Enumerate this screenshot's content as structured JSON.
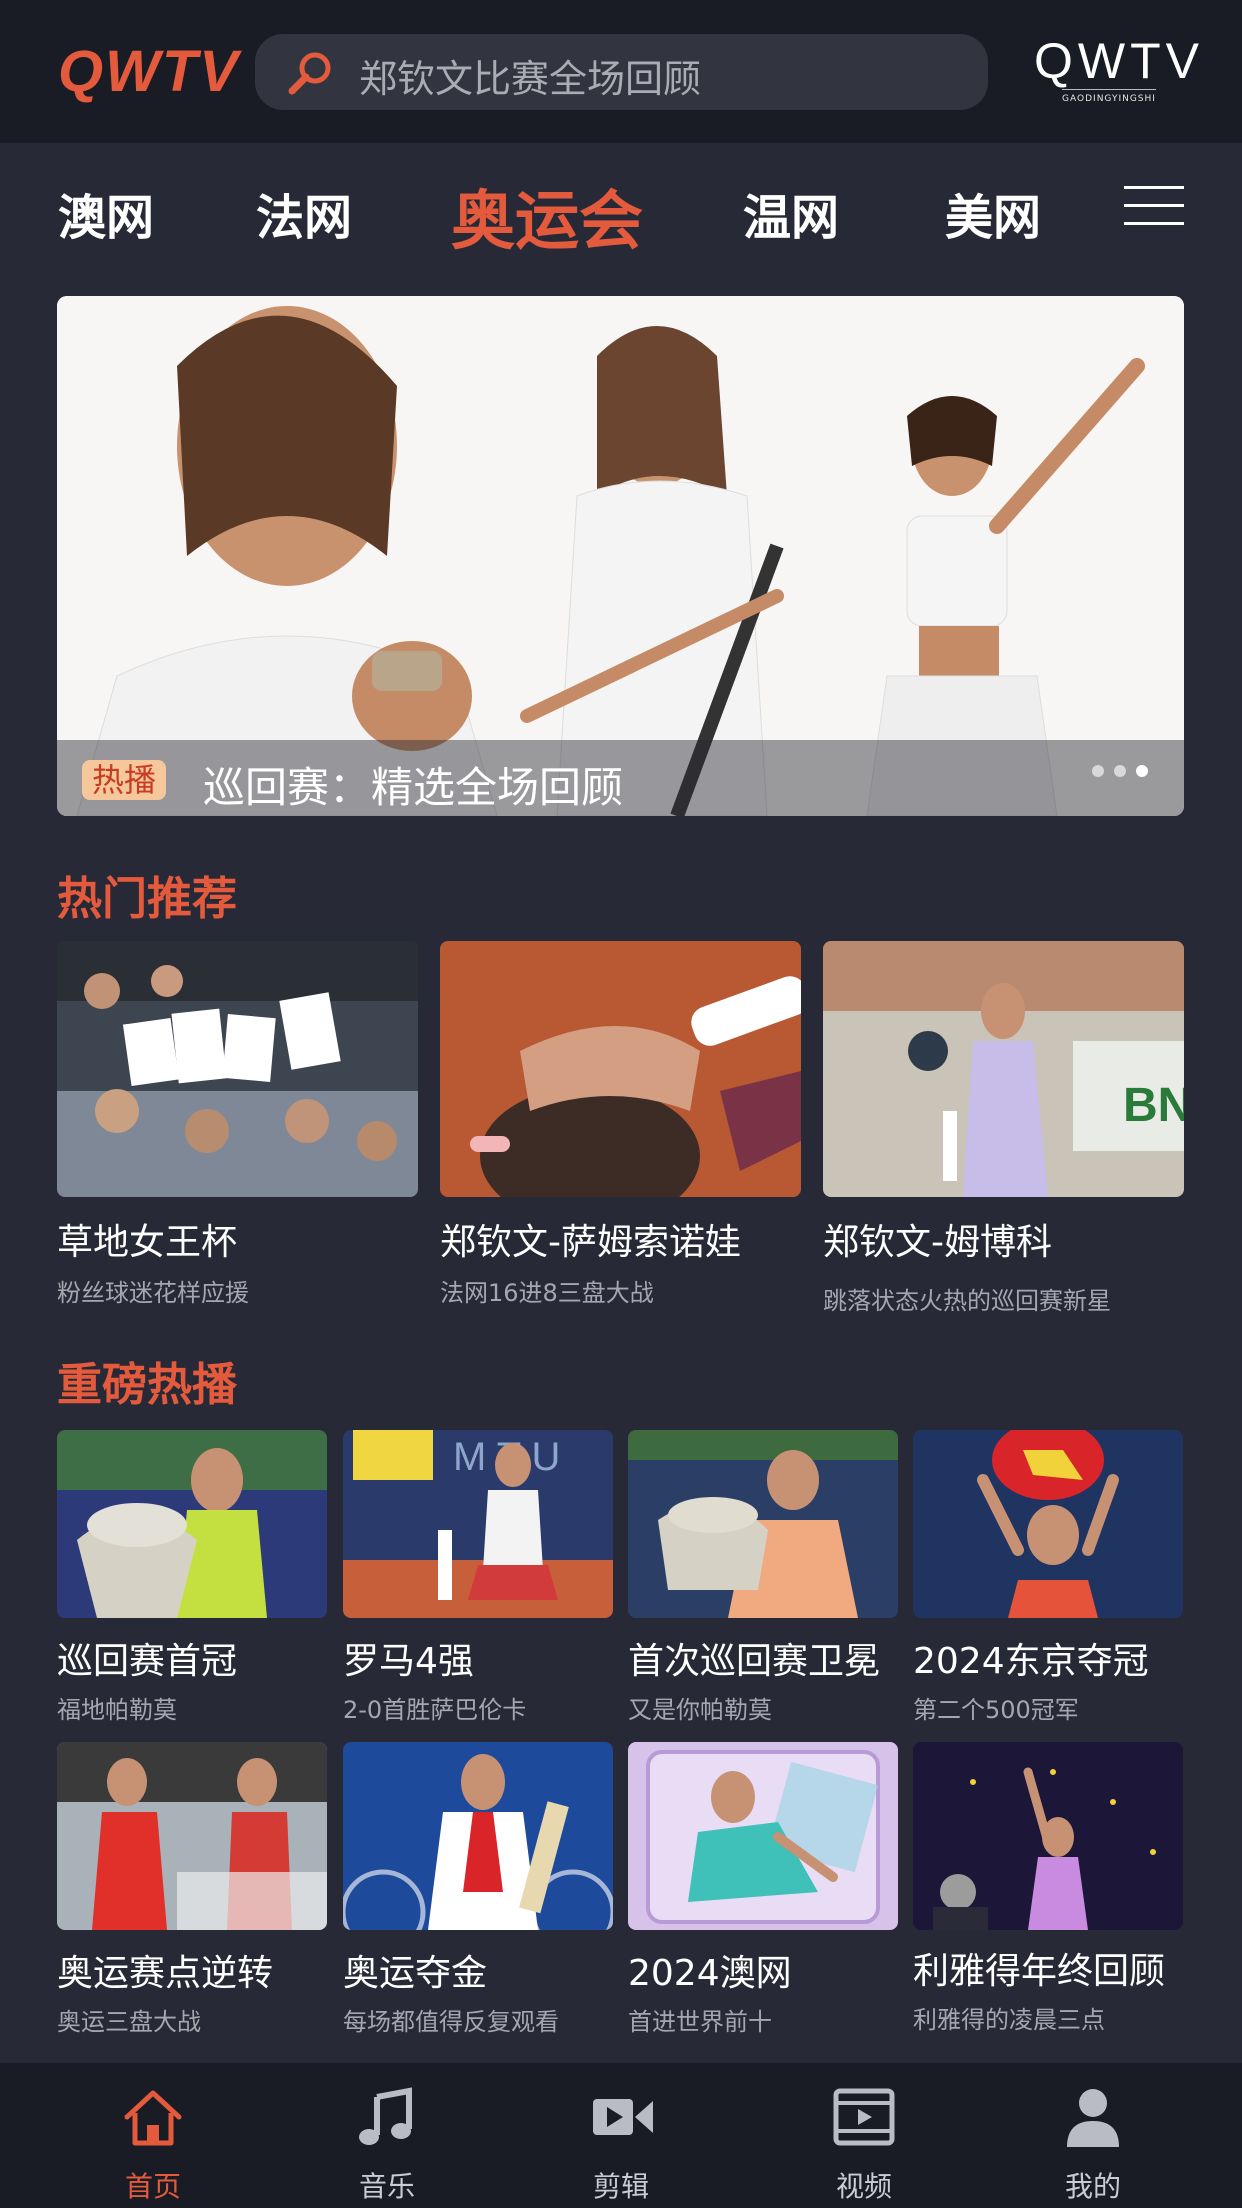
{
  "header": {
    "logo_left": "QWTV",
    "search_placeholder": "郑钦文比赛全场回顾",
    "logo_right": "QWTV",
    "logo_right_sub": "GAODINGYINGSHI"
  },
  "nav": {
    "items": [
      "澳网",
      "法网",
      "奥运会",
      "温网",
      "美网"
    ],
    "active": "奥运会"
  },
  "banner": {
    "badge": "热播",
    "title": "巡回赛：精选全场回顾",
    "dots": 3,
    "active_dot": 3
  },
  "hot": {
    "title": "热门推荐",
    "cards": [
      {
        "title": "草地女王杯",
        "subtitle": "粉丝球迷花样应援"
      },
      {
        "title": "郑钦文-萨姆索诺娃",
        "subtitle": "法网16进8三盘大战"
      },
      {
        "title": "郑钦文-姆博科",
        "subtitle": "跳落状态火热的巡回赛新星"
      }
    ]
  },
  "featured": {
    "title": "重磅热播",
    "cards": [
      {
        "title": "巡回赛首冠",
        "subtitle": "福地帕勒莫"
      },
      {
        "title": "罗马4强",
        "subtitle": "2-0首胜萨巴伦卡"
      },
      {
        "title": "首次巡回赛卫冕",
        "subtitle": "又是你帕勒莫"
      },
      {
        "title": "2024东京夺冠",
        "subtitle": "第二个500冠军"
      },
      {
        "title": "奥运赛点逆转",
        "subtitle": "奥运三盘大战"
      },
      {
        "title": "奥运夺金",
        "subtitle": "每场都值得反复观看"
      },
      {
        "title": "2024澳网",
        "subtitle": "首进世界前十"
      },
      {
        "title": "利雅得年终回顾",
        "subtitle": "利雅得的凌晨三点"
      }
    ]
  },
  "tabbar": {
    "items": [
      {
        "label": "首页",
        "icon": "home-icon"
      },
      {
        "label": "音乐",
        "icon": "music-note-icon"
      },
      {
        "label": "剪辑",
        "icon": "video-camera-icon"
      },
      {
        "label": "视频",
        "icon": "film-icon"
      },
      {
        "label": "我的",
        "icon": "user-icon"
      }
    ],
    "active": "首页"
  },
  "colors": {
    "accent": "#e35a3c",
    "background": "#272a36",
    "header_bg": "#1a1c25"
  }
}
